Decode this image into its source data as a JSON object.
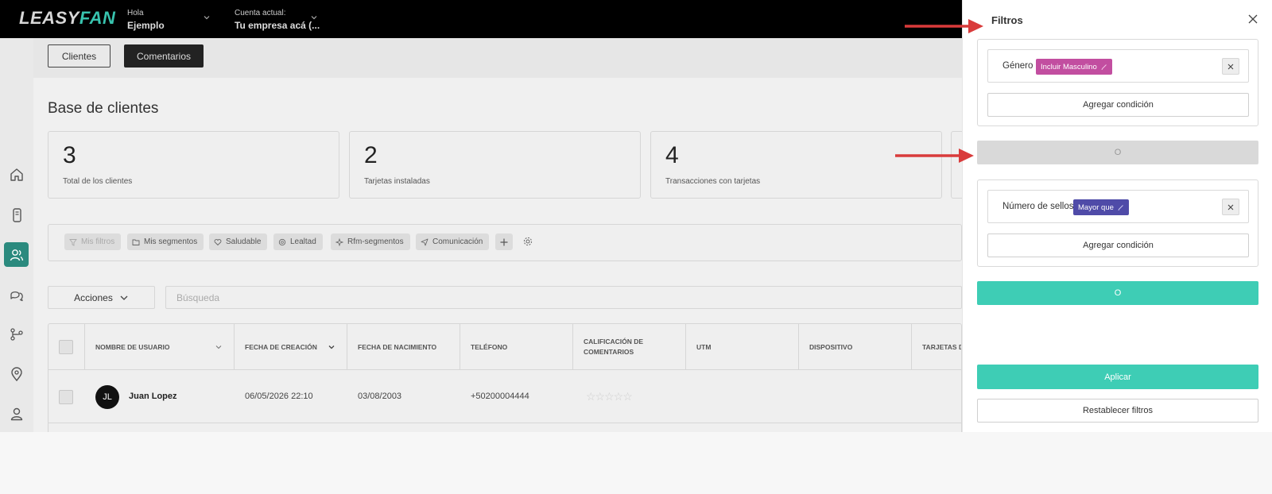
{
  "brand": {
    "logo_part1": "LEASY",
    "logo_part2": "FAN",
    "accent": "#38c3ae"
  },
  "header": {
    "greeting_label": "Hola",
    "greeting_name": "Ejemplo",
    "account_label": "Cuenta actual:",
    "account_name": "Tu empresa acá (..."
  },
  "sidebar": {
    "items": [
      {
        "icon": "home-icon"
      },
      {
        "icon": "card-device-icon"
      },
      {
        "icon": "users-icon",
        "active": true
      },
      {
        "icon": "chat-icon"
      },
      {
        "icon": "flow-icon"
      },
      {
        "icon": "location-pin-icon"
      },
      {
        "icon": "user-icon"
      }
    ]
  },
  "tabs": {
    "clients": "Clientes",
    "comments": "Comentarios"
  },
  "page_title": "Base de clientes",
  "stats": [
    {
      "value": "3",
      "label": "Total de los clientes"
    },
    {
      "value": "2",
      "label": "Tarjetas instaladas"
    },
    {
      "value": "4",
      "label": "Transacciones con tarjetas"
    }
  ],
  "filter_chips": [
    {
      "label": "Mis filtros",
      "icon": "filter-icon"
    },
    {
      "label": "Mis segmentos",
      "icon": "folder-icon"
    },
    {
      "label": "Saludable",
      "icon": "heart-icon"
    },
    {
      "label": "Lealtad",
      "icon": "circle-icon"
    },
    {
      "label": "Rfm-segmentos",
      "icon": "sparkle-icon"
    },
    {
      "label": "Comunicación",
      "icon": "send-icon"
    }
  ],
  "toolbar": {
    "actions_label": "Acciones",
    "search_placeholder": "Búsqueda"
  },
  "table": {
    "columns": [
      "NOMBRE DE USUARIO",
      "FECHA DE CREACIÓN",
      "FECHA DE NACIMIENTO",
      "TELÉFONO",
      "CALIFICACIÓN DE COMENTARIOS",
      "UTM",
      "DISPOSITIVO",
      "TARJETAS D"
    ],
    "rows": [
      {
        "initials": "JL",
        "name": "Juan Lopez",
        "created": "06/05/2026 22:10",
        "birth": "03/08/2003",
        "phone": "+50200004444",
        "rating_stars": 0
      }
    ]
  },
  "filters_panel": {
    "title": "Filtros",
    "group1": {
      "condition_label": "Género",
      "condition_value": "Incluir Masculino",
      "add_condition": "Agregar condición"
    },
    "or_separator": "O",
    "group2": {
      "condition_label": "Número de sellos",
      "condition_value": "Mayor que",
      "add_condition": "Agregar condición"
    },
    "or_button": "O",
    "apply": "Aplicar",
    "reset": "Restablecer filtros",
    "colors": {
      "teal": "#3ecdb5",
      "pink": "#c24ea0",
      "purple": "#4f4ba8",
      "arrow": "#d93b3b"
    }
  }
}
